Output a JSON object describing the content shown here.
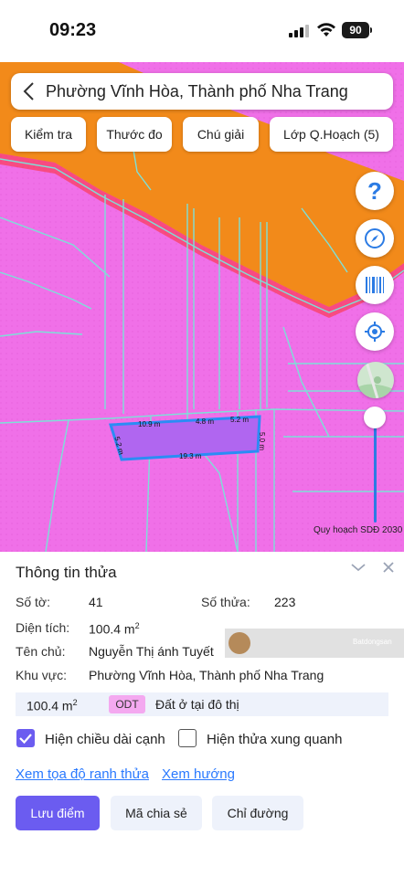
{
  "status_bar": {
    "time": "09:23",
    "battery": "90"
  },
  "header": {
    "title": "Phường Vĩnh Hòa, Thành phố Nha Trang"
  },
  "toolbar": {
    "chips": [
      "Kiểm tra",
      "Thước đo",
      "Chú giải",
      "Lớp Q.Hoạch (5)"
    ]
  },
  "map_controls": {
    "help": "?",
    "icons": [
      "help-icon",
      "compass-icon",
      "barcode-icon",
      "my-location-icon",
      "map-thumbnail"
    ]
  },
  "map": {
    "plan_label": "Quy hoạch SDĐ 2030",
    "dimensions": {
      "top_left": "10.9 m",
      "top_mid": "4.8 m",
      "top_right": "5.2 m",
      "right": "5.0 m",
      "bottom": "19.3 m",
      "left": "5.2 m"
    },
    "colors": {
      "residential": "#f070e8",
      "road": "#f28a1a",
      "boundary": "#7de0d8",
      "selected_outline": "#2b8cf5"
    }
  },
  "panel": {
    "title": "Thông tin thửa",
    "so_to_label": "Số tờ:",
    "so_to": "41",
    "so_thua_label": "Số thửa:",
    "so_thua": "223",
    "dien_tich_label": "Diện tích:",
    "dien_tich": "100.4 m",
    "dien_tich_sup": "2",
    "ten_chu_label": "Tên chủ:",
    "ten_chu": "Nguyễn Thị ánh Tuyết",
    "khu_vuc_label": "Khu vực:",
    "khu_vuc": "Phường Vĩnh Hòa, Thành phố Nha Trang",
    "usage_area": "100.4 m",
    "usage_area_sup": "2",
    "usage_code": "ODT",
    "usage_desc": "Đất ở tại đô thị",
    "check_edges": "Hiện chiều dài cạnh",
    "check_edges_on": true,
    "check_neighbors": "Hiện thửa xung quanh",
    "check_neighbors_on": false,
    "link_coords": "Xem tọa độ ranh thửa",
    "link_direction": "Xem hướng",
    "btn_save": "Lưu điểm",
    "btn_share": "Mã chia sẻ",
    "btn_route": "Chỉ đường",
    "watermark": "Batdongsan"
  }
}
